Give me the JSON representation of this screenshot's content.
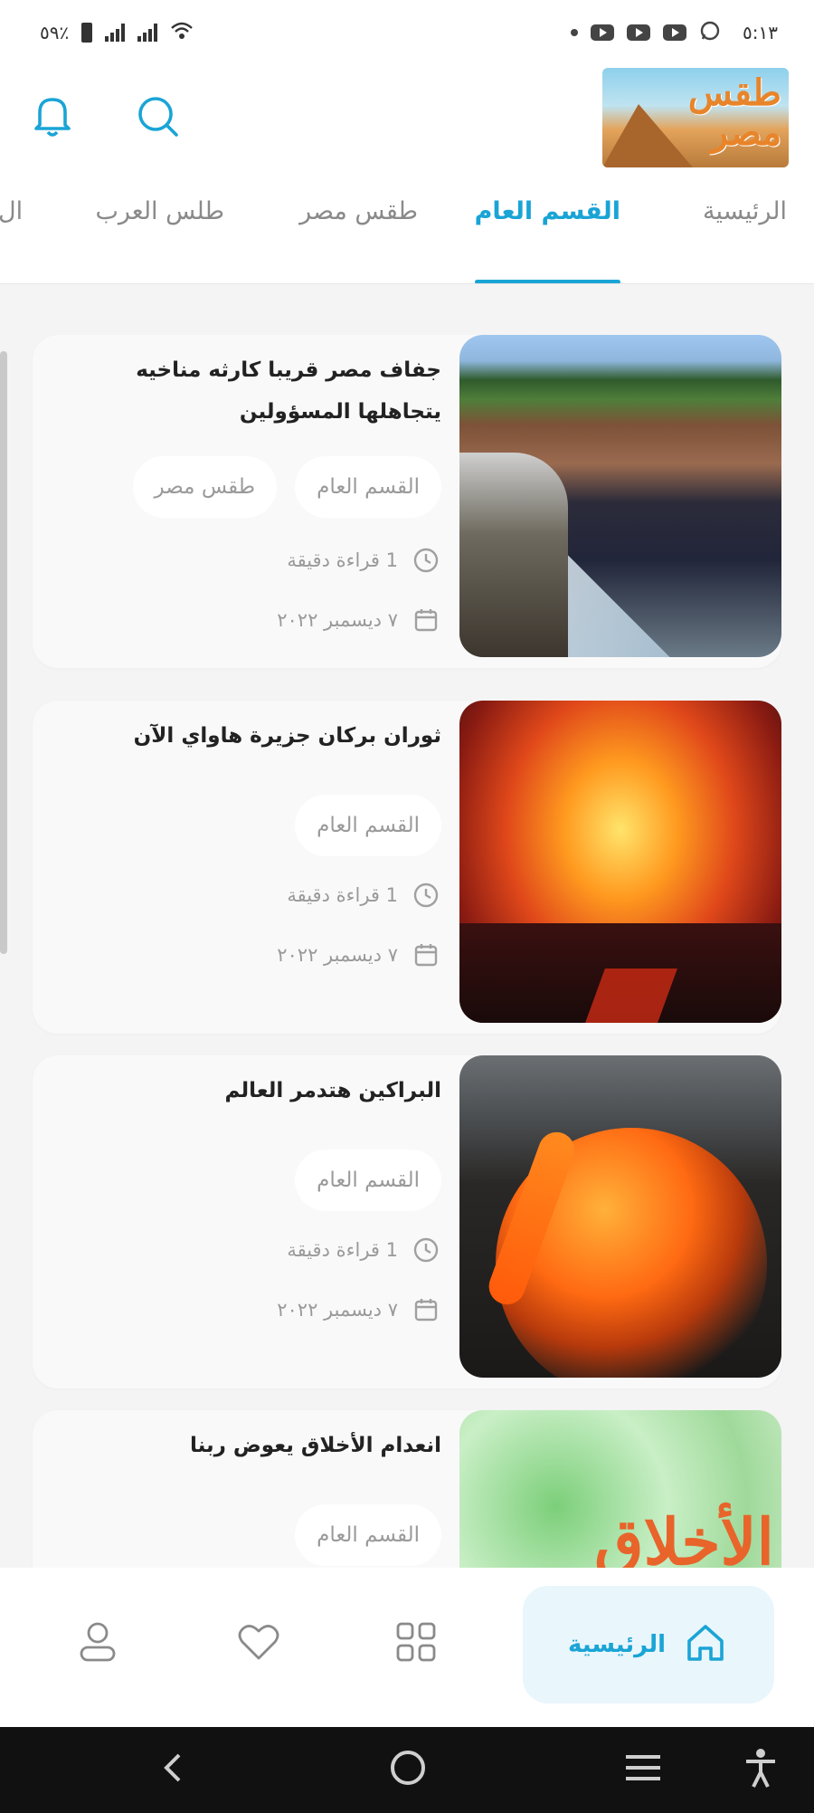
{
  "status_bar": {
    "time": "٥:١٣",
    "battery_percent": "٥٩٪"
  },
  "header": {
    "logo_text": "طقس مصر"
  },
  "tabs": [
    {
      "label": "الرئيسية",
      "active": false
    },
    {
      "label": "القسم العام",
      "active": true
    },
    {
      "label": "طقس مصر",
      "active": false
    },
    {
      "label": "طلس العرب",
      "active": false
    },
    {
      "label": "ال",
      "active": false
    }
  ],
  "articles": [
    {
      "title": "جفاف مصر قريبا كارثه مناخيه يتجاهلها المسؤولين",
      "tags": [
        "القسم العام",
        "طقس مصر"
      ],
      "read_time": "1 قراءة دقيقة",
      "date": "٧ ديسمبر ٢٠٢٢",
      "image": "drought-irrigation-photo"
    },
    {
      "title": "ثوران بركان جزيرة هاواي الآن",
      "tags": [
        "القسم العام"
      ],
      "read_time": "1 قراءة دقيقة",
      "date": "٧ ديسمبر ٢٠٢٢",
      "image": "volcano-eruption-photo"
    },
    {
      "title": "البراكين هتدمر العالم",
      "tags": [
        "القسم العام"
      ],
      "read_time": "1 قراءة دقيقة",
      "date": "٧ ديسمبر ٢٠٢٢",
      "image": "lava-flow-photo"
    },
    {
      "title": "انعدام الأخلاق يعوض ربنا",
      "tags": [
        "القسم العام"
      ],
      "image": "ethics-text-image",
      "image_text": "الأخلاق"
    }
  ],
  "bottom_nav": {
    "home_label": "الرئيسية"
  },
  "colors": {
    "accent": "#1aa4d6",
    "feed_bg": "#f4f4f4",
    "card_bg": "#f9f9f9"
  }
}
